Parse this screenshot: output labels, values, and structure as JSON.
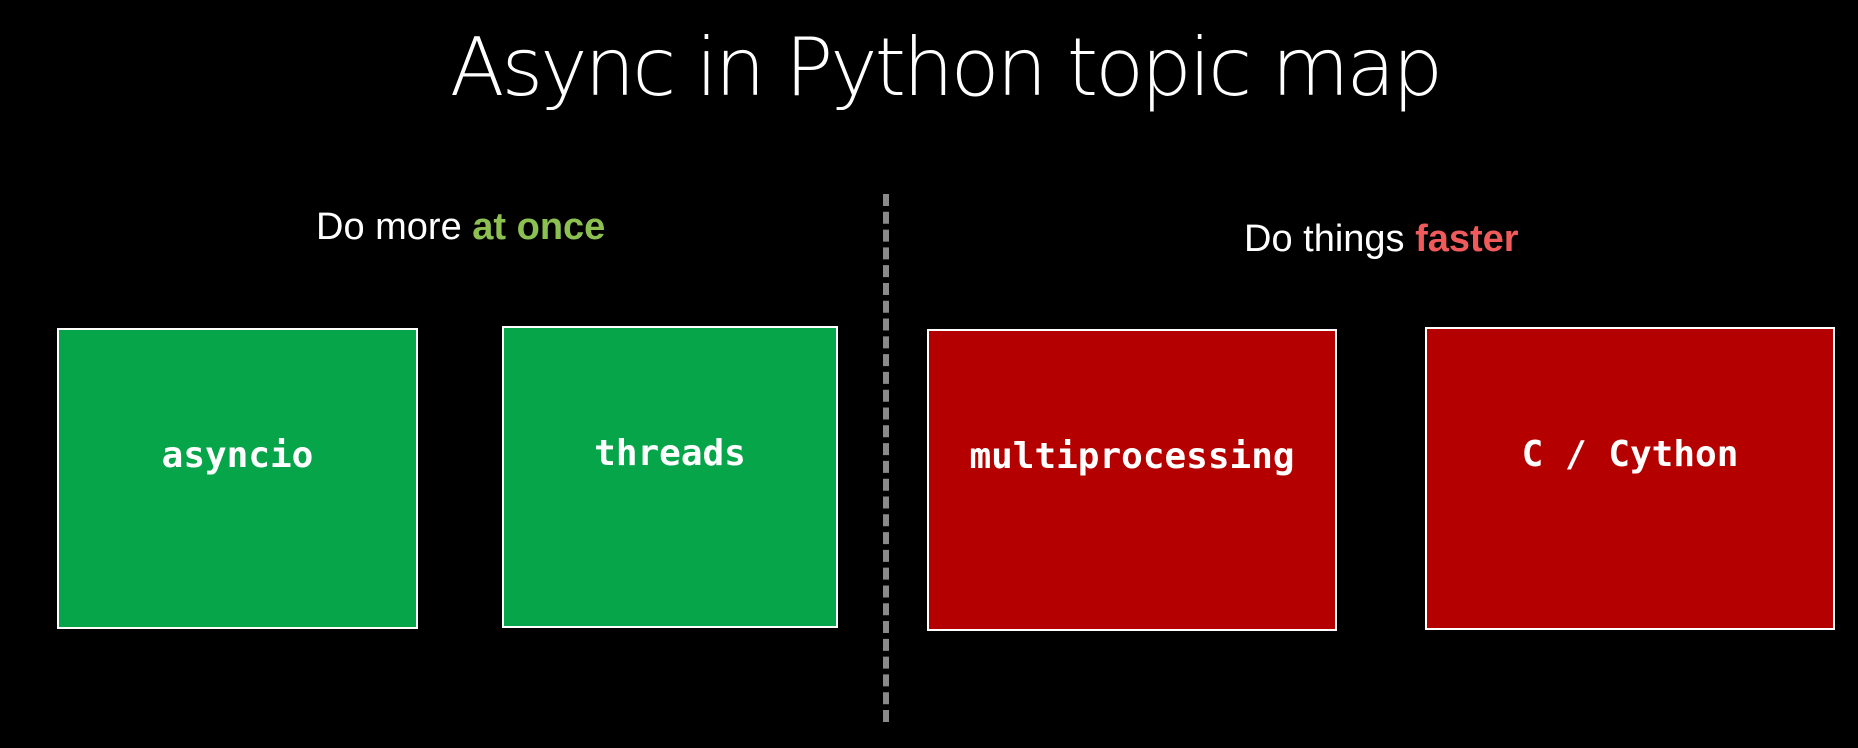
{
  "title": "Async in Python topic map",
  "colors": {
    "background": "#000000",
    "concurrency_accent": "#8cc152",
    "speed_accent": "#f05a5a",
    "concurrency_box": "#07a54a",
    "speed_box": "#b50000",
    "divider": "#8a8a8a"
  },
  "left": {
    "heading_prefix": "Do more ",
    "heading_highlight": "at once",
    "boxes": [
      {
        "label": "asyncio"
      },
      {
        "label": "threads"
      }
    ]
  },
  "right": {
    "heading_prefix": "Do things ",
    "heading_highlight": "faster",
    "boxes": [
      {
        "label": "multiprocessing"
      },
      {
        "label": "C / Cython"
      }
    ]
  }
}
